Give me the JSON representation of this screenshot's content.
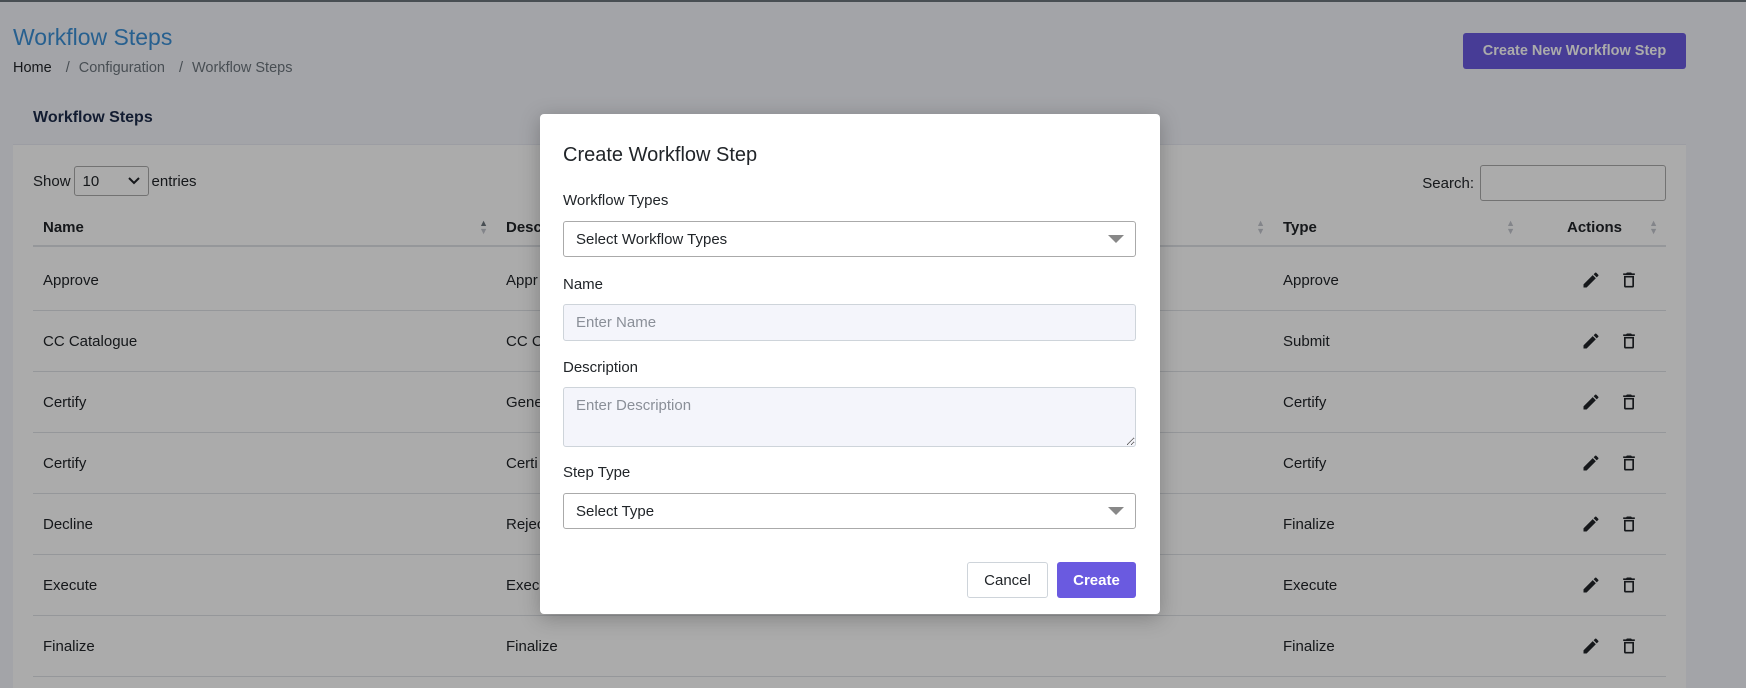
{
  "page": {
    "title": "Workflow Steps",
    "breadcrumb": [
      "Home",
      "Configuration",
      "Workflow Steps"
    ],
    "create_button": "Create New Workflow Step"
  },
  "card": {
    "title": "Workflow Steps",
    "show_label": "Show",
    "entries_label": "entries",
    "page_size": "10",
    "search_label": "Search:"
  },
  "table": {
    "columns": [
      "Name",
      "Desc",
      "Type",
      "Actions"
    ],
    "rows": [
      {
        "name": "Approve",
        "description": "Appr",
        "type": "Approve"
      },
      {
        "name": "CC Catalogue",
        "description": "CC C",
        "type": "Submit"
      },
      {
        "name": "Certify",
        "description": "Gene",
        "type": "Certify"
      },
      {
        "name": "Certify",
        "description": "Certi",
        "type": "Certify"
      },
      {
        "name": "Decline",
        "description": "Rejec",
        "type": "Finalize"
      },
      {
        "name": "Execute",
        "description": "Exec",
        "type": "Execute"
      },
      {
        "name": "Finalize",
        "description": "Finalize",
        "type": "Finalize"
      }
    ]
  },
  "modal": {
    "title": "Create Workflow Step",
    "workflow_types_label": "Workflow Types",
    "workflow_types_value": "Select Workflow Types",
    "name_label": "Name",
    "name_placeholder": "Enter Name",
    "description_label": "Description",
    "description_placeholder": "Enter Description",
    "step_type_label": "Step Type",
    "step_type_value": "Select Type",
    "cancel": "Cancel",
    "create": "Create"
  },
  "icons": {
    "edit": "pencil-icon",
    "delete": "trash-icon",
    "dropdown": "chevron-down-icon",
    "sort": "sort-icon"
  },
  "colors": {
    "accent": "#6a5ae0",
    "title": "#3b8fd6"
  }
}
